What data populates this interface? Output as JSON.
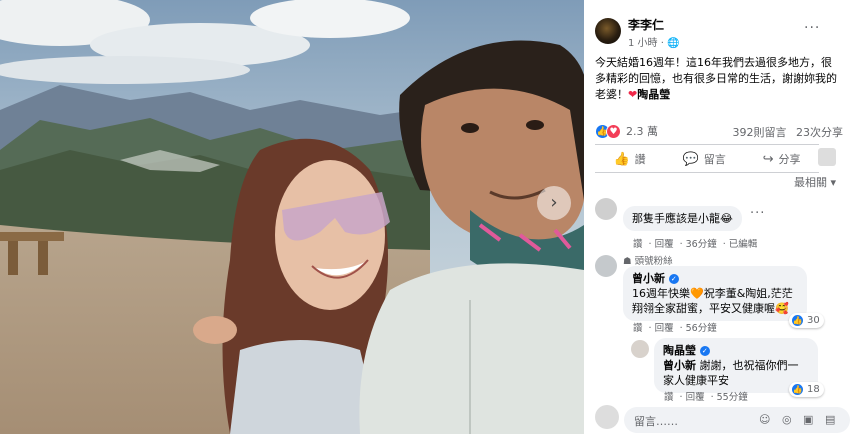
{
  "photo": {
    "next_label": "›"
  },
  "post": {
    "author": "李李仁",
    "time": "1 小時",
    "audience_icon": "globe-icon",
    "more_label": "···",
    "text_main": "今天結婚16週年！這16年我們去過很多地方，很多精彩的回憶，也有很多日常的生活，謝謝妳我的老婆！",
    "heart": "❤",
    "tagged": "陶晶瑩"
  },
  "stats": {
    "reaction_count": "2.3 萬",
    "comments": "392則留言",
    "shares": "23次分享"
  },
  "actions": {
    "like": "讚",
    "comment": "留言",
    "share": "分享"
  },
  "sort": {
    "label": "最相關",
    "chevron": "▾"
  },
  "comments": [
    {
      "text": "那隻手應該是小龍",
      "emoji": "😂",
      "like": "讚",
      "reply": "回覆",
      "time": "36分鐘",
      "edited": "已編輯"
    },
    {
      "badge": "頭號粉絲",
      "name": "曾小新",
      "text": "16週年快樂🧡祝李董&陶姐,茫茫翔翎全家甜蜜，平安又健康喔🥰",
      "like": "讚",
      "reply": "回覆",
      "time": "56分鐘",
      "likes": "30"
    },
    {
      "name": "陶晶瑩",
      "mention": "曾小新",
      "text": " 謝謝，也祝福你們一家人健康平安",
      "like": "讚",
      "reply": "回覆",
      "time": "55分鐘",
      "likes": "18"
    }
  ],
  "composer": {
    "placeholder": "留言……",
    "icons": "☺ ◎ ▣ ▤"
  },
  "colors": {
    "facebook_blue": "#1877f2",
    "love_red": "#f33e58",
    "bubble_gray": "#f0f2f5"
  }
}
